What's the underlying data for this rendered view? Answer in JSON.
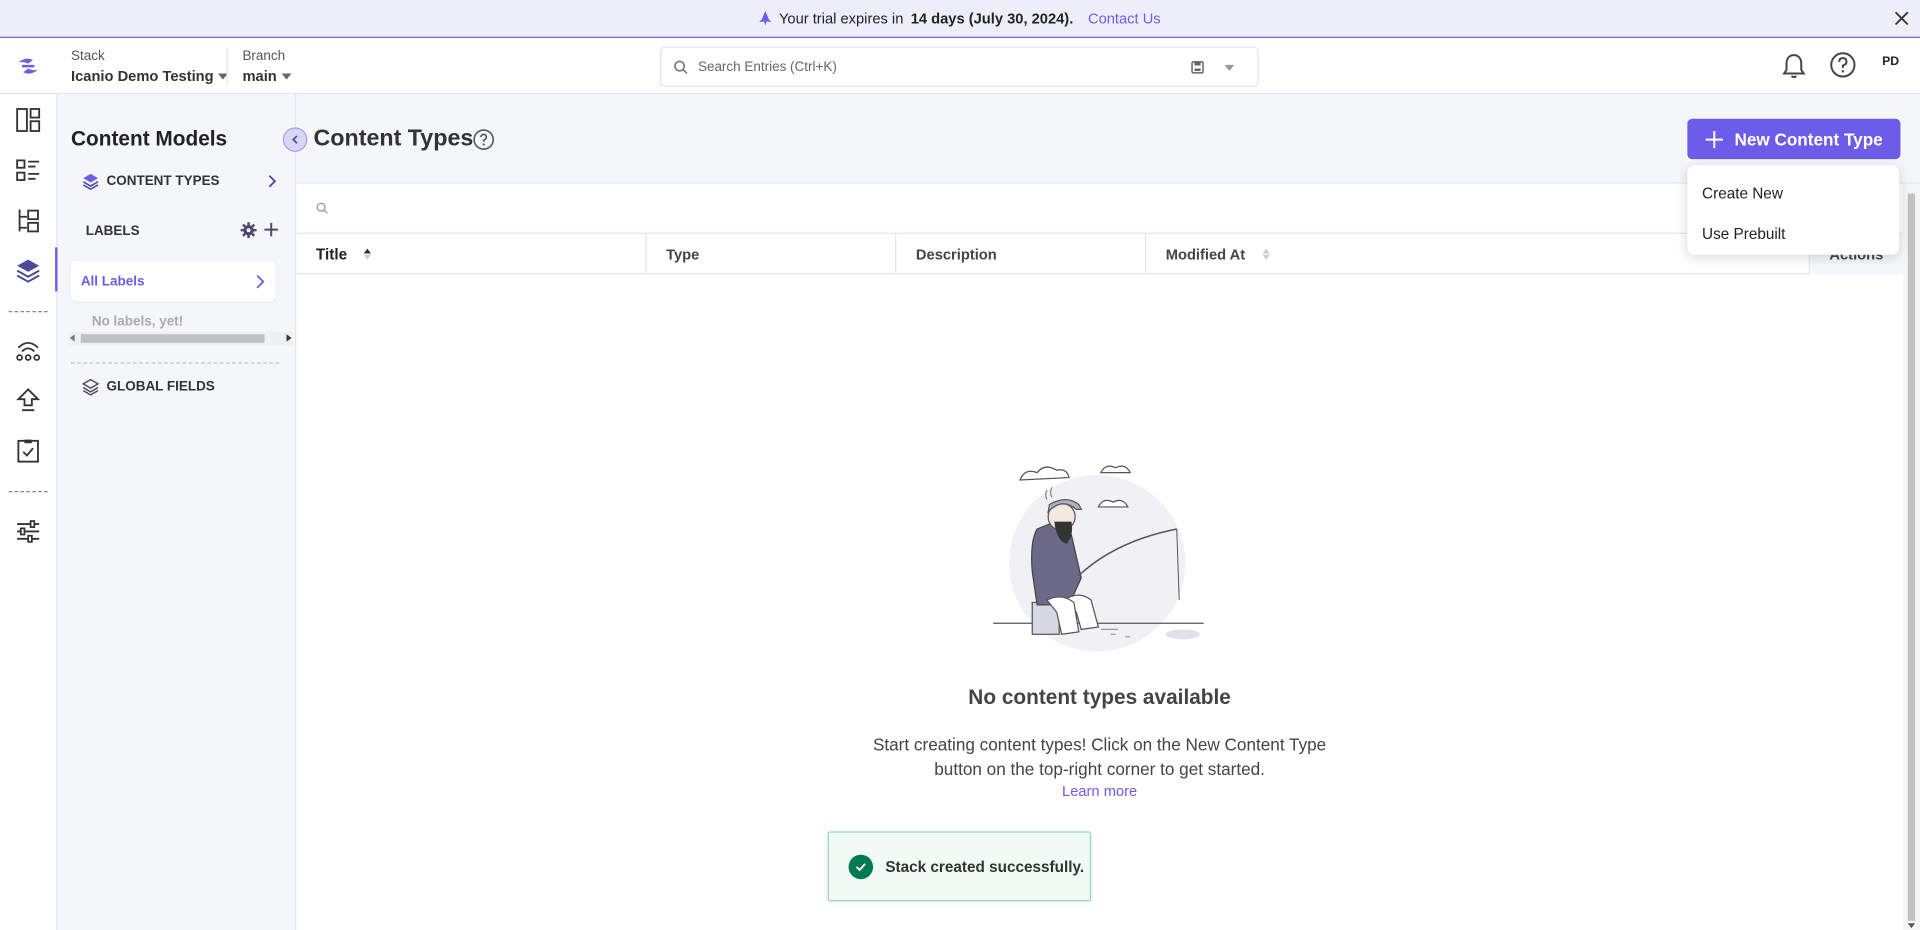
{
  "banner": {
    "prefix": "Your trial expires in",
    "emphasis": "14 days (July 30, 2024).",
    "contact": "Contact Us",
    "accent": "#6c5ce7"
  },
  "header": {
    "stack_label": "Stack",
    "stack_value": "Icanio Demo Testing",
    "branch_label": "Branch",
    "branch_value": "main",
    "search_placeholder": "Search Entries (Ctrl+K)",
    "avatar_initials": "PD"
  },
  "rail": {
    "icons": [
      "dashboard-icon",
      "entries-icon",
      "assets-icon",
      "content-models-icon",
      "releases-icon",
      "deploy-icon",
      "tasks-icon",
      "settings-icon"
    ]
  },
  "panel": {
    "title": "Content Models",
    "content_types_label": "CONTENT TYPES",
    "labels_heading": "LABELS",
    "all_labels": "All Labels",
    "no_labels": "No labels, yet!",
    "global_fields_label": "GLOBAL FIELDS"
  },
  "main": {
    "title": "Content Types",
    "new_button": "New Content Type",
    "columns": [
      "Title",
      "Type",
      "Description",
      "Modified At",
      "Actions"
    ],
    "empty_title": "No content types available",
    "empty_desc_line1": "Start creating content types! Click on the New Content Type",
    "empty_desc_line2": "button on the top-right corner to get started.",
    "learn_more": "Learn more"
  },
  "dropdown": {
    "options": [
      "Create New",
      "Use Prebuilt"
    ]
  },
  "toast": {
    "message": "Stack created successfully.",
    "color": "#007a52"
  }
}
